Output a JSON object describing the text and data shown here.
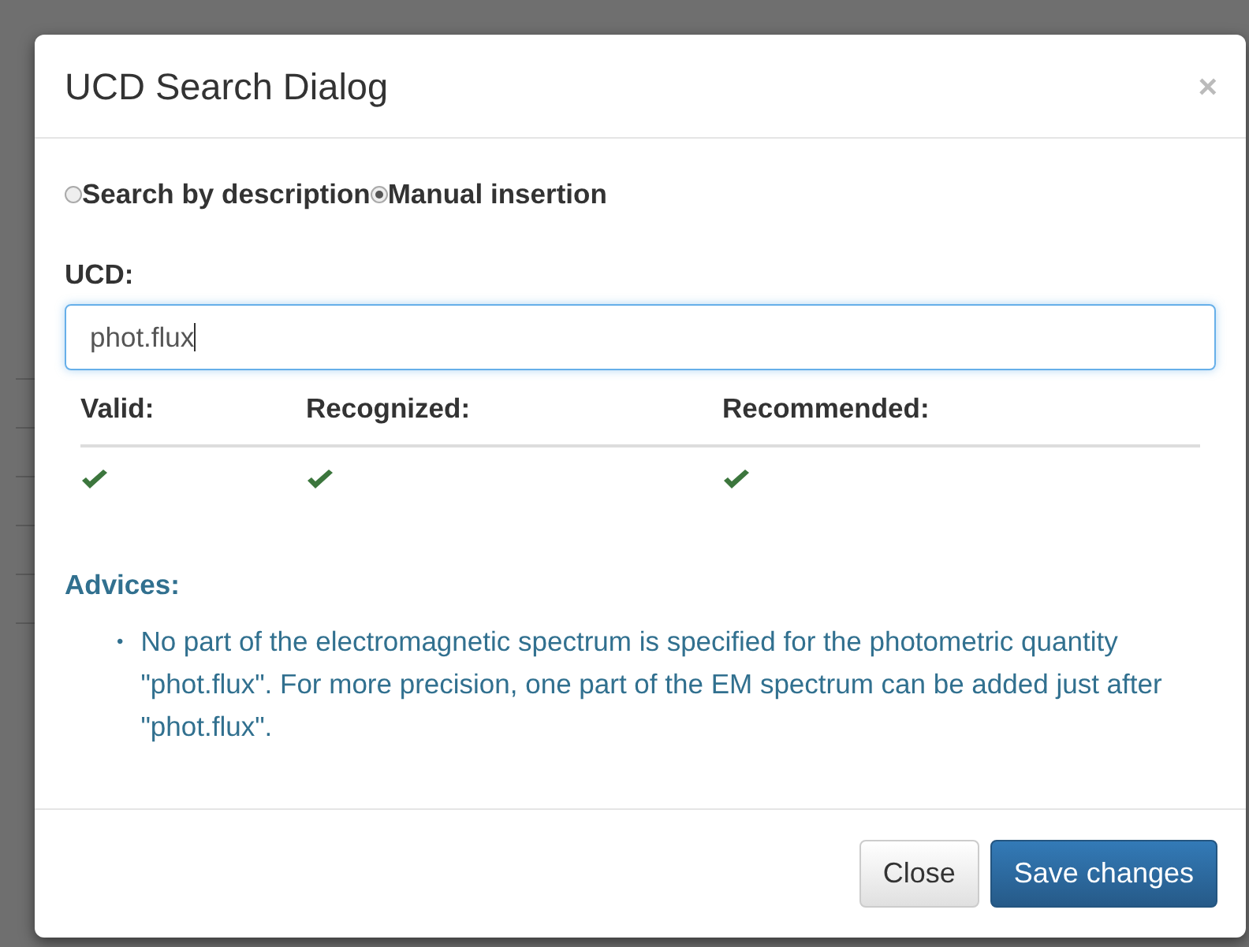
{
  "dialog": {
    "title": "UCD Search Dialog",
    "close_icon": "×"
  },
  "modes": [
    {
      "label": "Search by description",
      "selected": false
    },
    {
      "label": "Manual insertion",
      "selected": true
    }
  ],
  "ucd": {
    "label": "UCD:",
    "value": "phot.flux"
  },
  "checks": [
    {
      "label": "Valid:",
      "passed": true
    },
    {
      "label": "Recognized:",
      "passed": true
    },
    {
      "label": "Recommended:",
      "passed": true
    }
  ],
  "advices": {
    "title": "Advices:",
    "bullet": "•",
    "items": [
      "No part of the electromagnetic spectrum is specified for the photometric quantity \"phot.flux\". For more precision, one part of the EM spectrum can be added just after \"phot.flux\"."
    ]
  },
  "buttons": [
    {
      "label": "Close",
      "kind": "default"
    },
    {
      "label": "Save changes",
      "kind": "primary"
    }
  ]
}
